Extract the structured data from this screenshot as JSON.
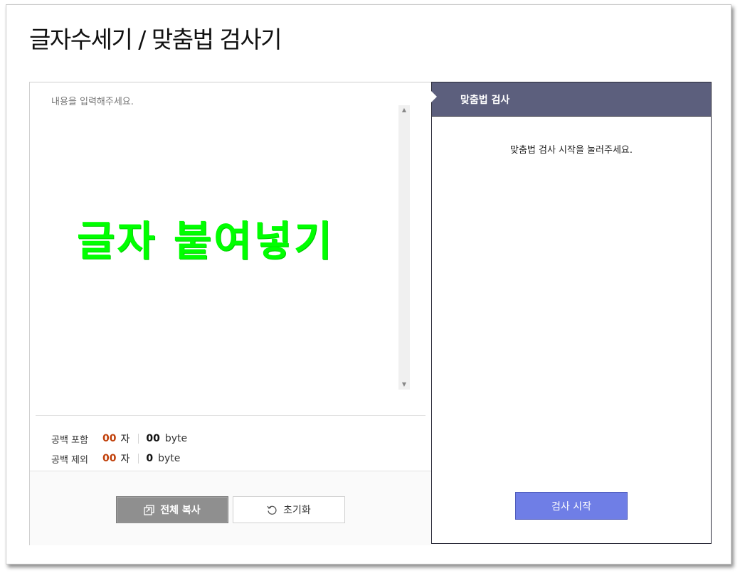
{
  "page": {
    "title": "글자수세기 / 맞춤법 검사기"
  },
  "editor": {
    "placeholder": "내용을 입력해주세요.",
    "overlay_text": "글자 붙여넣기",
    "overlay_color": "#00ff00"
  },
  "counts": {
    "with_spaces": {
      "label": "공백 포함",
      "chars": "00",
      "unit": "자",
      "bytes": "00",
      "byte_unit": "byte"
    },
    "without_spaces": {
      "label": "공백 제외",
      "chars": "00",
      "unit": "자",
      "bytes": "0",
      "byte_unit": "byte"
    }
  },
  "buttons": {
    "copy_all": "전체 복사",
    "reset": "초기화"
  },
  "checker": {
    "header": "맞춤법 검사",
    "message": "맞춤법 검사 시작을 눌러주세요.",
    "start_button": "검사 시작",
    "accent": "#6f7ee6",
    "header_color": "#5c5f7d"
  }
}
